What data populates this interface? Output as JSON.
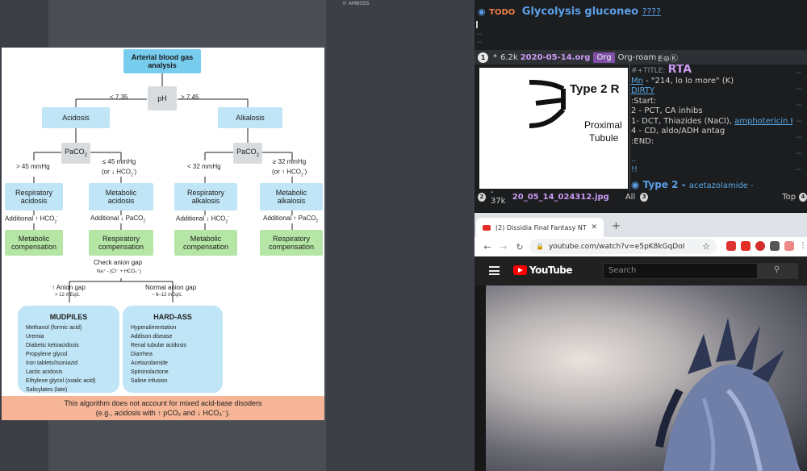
{
  "watermark": "© AMBOSS",
  "figure": {
    "root": "Arterial blood gas analysis",
    "ph": "pH",
    "ph_low": "< 7.35",
    "ph_high": "> 7.45",
    "acidosis": "Acidosis",
    "alkalosis": "Alkalosis",
    "paco2": "PaCO",
    "sub2": "2",
    "acid_left": "> 45 mmHg",
    "acid_right_1": "≤ 45 mmHg",
    "acid_right_2": "(or ↓ HCO",
    "alk_left": "< 32 mmHg",
    "alk_right_1": "≥ 32 mmHg",
    "alk_right_2": "(or ↑ HCO",
    "sup_minus": "-",
    "close_paren": ")",
    "resp_acidosis": "Respiratory acidosis",
    "met_acidosis": "Metabolic acidosis",
    "resp_alkalosis": "Respiratory alkalosis",
    "met_alkalosis": "Metabolic alkalosis",
    "add_up_hco3": "Additional ↑ HCO",
    "add_down_paco2": "Additional ↓ PaCO",
    "add_down_hco3": "Additional ↓ HCO",
    "add_up_paco2": "Additional ↑ PaCO",
    "met_comp": "Metabolic compensation",
    "resp_comp": "Respiratory compensation",
    "anion_gap": "Check anion gap",
    "anion_formula": "Na⁺ - (Cl⁻ + HCO₃⁻)",
    "ag_high": "↑ Anion gap",
    "ag_high_val": "> 12 mEq/L",
    "ag_normal": "Normal anion gap",
    "ag_normal_val": "~ 6–12 mEq/L",
    "mudpiles_title": "MUDPILES",
    "mudpiles": [
      "Methanol (formic acid)",
      "Uremia",
      "Diabetic ketoacidosis",
      "Propylene glycol",
      "Iron tablets/Isoniazid",
      "Lactic acidosis",
      "Ethylene glycol (oxalic acid)",
      "Salicylates (late)"
    ],
    "hardass_title": "HARD-ASS",
    "hardass": [
      "Hyperalimentation",
      "Addison disease",
      "Renal tubular acidosis",
      "Diarrhea",
      "Acetazolamide",
      "Spironolactone",
      "Saline infusion"
    ],
    "footer_1": "This algorithm does not account for mixed acid-base disoders",
    "footer_2": "(e.g., acidosis with ↑ pCO₂ and ↓ HCO₃⁻)."
  },
  "emacs": {
    "todo": "TODO",
    "heading": "Glycolysis gluconeo",
    "heading_q": "????",
    "ml1_num": "1",
    "ml1_star": "*",
    "ml1_size": "6.2k",
    "ml1_file": "2020-05-14.org",
    "ml1_mode": "Org",
    "ml1_minor": "Org-roam",
    "ml1_icons": "E⊜Ⓚ",
    "img_title": "Type 2 R",
    "img_l1": "Proximal",
    "img_l2": "Tubule",
    "org_title_kw": "#+TITLE:",
    "org_title": "RTA",
    "org_line1_link": "Mn",
    "org_line1": " - \"214, lo lo more\" (K)",
    "org_dirty": "DIRTY",
    "org_start": ":Start:",
    "org_l2": "2 - PCT, CA inhibs",
    "org_l3": "1- DCT, Thiazides (NaCl), ",
    "org_l3_link": "amphotericin B",
    "org_l4": "4 - CD, aldo/ADH antag",
    "org_end": ":END:",
    "org_dots": "..",
    "org_bang": "!!",
    "org_h2": "Type 2 - ",
    "org_h2_small": "acetazolamide -",
    "ml2_num": "2",
    "ml2_size": "- 37k",
    "ml2_file": "20_05_14_024312.jpg",
    "ml2_all": "All",
    "ml2_num3": "3",
    "ml2_top": "Top",
    "ml2_num4": "4"
  },
  "browser": {
    "tab_title": "(2) Dissidia Final Fantasy NT",
    "tab_close": "✕",
    "new_tab": "+",
    "url": "youtube.com/watch?v=e5pK8kGqDoI",
    "yt_brand": "YouTube",
    "yt_search_placeholder": "Search"
  }
}
